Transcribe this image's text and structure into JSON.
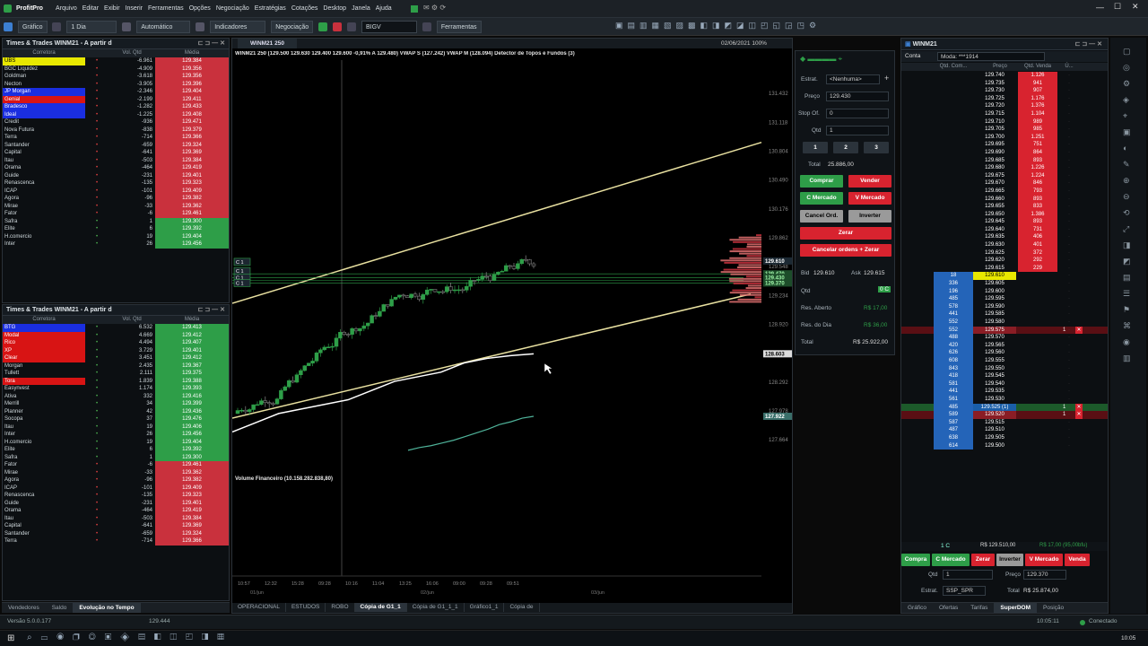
{
  "app": {
    "name": "ProfitPro"
  },
  "menu": [
    "Arquivo",
    "Editar",
    "Exibir",
    "Inserir",
    "Ferramentas",
    "Opções",
    "Negociação",
    "Estratégias",
    "Cotações",
    "Desktop",
    "Janela",
    "Ajuda"
  ],
  "toolbar": {
    "chart_label": "Gráfico",
    "period": "1 Dia",
    "mode": "Automático",
    "indicators": "Indicadores",
    "trading": "Negociação",
    "ticker": "BIGV",
    "tools": "Ferramentas"
  },
  "tt_top": {
    "title": "Times & Trades WINM21 - A partir d",
    "headers": {
      "broker": "Corretora",
      "qty": "Vol. Qtd",
      "avg": "Média"
    },
    "rows": [
      {
        "name": "UBS",
        "qty": "-6.961",
        "avg": "129.384",
        "bg": "#e8e800",
        "fg": "#000"
      },
      {
        "name": "BGC Liquidez",
        "qty": "-4.909",
        "avg": "129.356"
      },
      {
        "name": "Goldman",
        "qty": "-3.618",
        "avg": "129.356"
      },
      {
        "name": "Necton",
        "qty": "-3.905",
        "avg": "129.396"
      },
      {
        "name": "JP Morgan",
        "qty": "-2.346",
        "avg": "129.404",
        "bg": "#1a2ee0"
      },
      {
        "name": "Genial",
        "qty": "-2.199",
        "avg": "129.411",
        "bg": "#d81414"
      },
      {
        "name": "Bradesco",
        "qty": "-1.282",
        "avg": "129.433",
        "bg": "#1a2ee0"
      },
      {
        "name": "Ideal",
        "qty": "-1.225",
        "avg": "129.408",
        "bg": "#1a2ee0"
      },
      {
        "name": "Credit",
        "qty": "-936",
        "avg": "129.471"
      },
      {
        "name": "Nova Futura",
        "qty": "-838",
        "avg": "129.379"
      },
      {
        "name": "Terra",
        "qty": "-714",
        "avg": "129.366"
      },
      {
        "name": "Santander",
        "qty": "-659",
        "avg": "129.324"
      },
      {
        "name": "Capital",
        "qty": "-641",
        "avg": "129.369"
      },
      {
        "name": "Itau",
        "qty": "-503",
        "avg": "129.384"
      },
      {
        "name": "Orama",
        "qty": "-464",
        "avg": "129.419"
      },
      {
        "name": "Guide",
        "qty": "-231",
        "avg": "129.401"
      },
      {
        "name": "Renascenca",
        "qty": "-135",
        "avg": "129.323"
      },
      {
        "name": "ICAP",
        "qty": "-101",
        "avg": "129.409"
      },
      {
        "name": "Agora",
        "qty": "-96",
        "avg": "129.382"
      },
      {
        "name": "Mirae",
        "qty": "-33",
        "avg": "129.362"
      },
      {
        "name": "Fator",
        "qty": "-6",
        "avg": "129.461"
      },
      {
        "name": "Safra",
        "qty": "1",
        "avg": "129.300",
        "pos": true
      },
      {
        "name": "Elite",
        "qty": "6",
        "avg": "129.392",
        "pos": true
      },
      {
        "name": "H.comercio",
        "qty": "19",
        "avg": "129.404",
        "pos": true
      },
      {
        "name": "Inter",
        "qty": "26",
        "avg": "129.456",
        "pos": true
      }
    ]
  },
  "tt_bottom": {
    "title": "Times & Trades WINM21 - A partir d",
    "headers": {
      "broker": "Corretora",
      "qty": "Vol. Qtd",
      "avg": "Média"
    },
    "rows": [
      {
        "name": "BTG",
        "qty": "6.532",
        "avg": "129.413",
        "pos": true,
        "bg": "#1a2ee0"
      },
      {
        "name": "Modal",
        "qty": "4.669",
        "avg": "129.412",
        "pos": true,
        "bg": "#d81414"
      },
      {
        "name": "Rico",
        "qty": "4.494",
        "avg": "129.407",
        "pos": true,
        "bg": "#d81414"
      },
      {
        "name": "XP",
        "qty": "3.729",
        "avg": "129.401",
        "pos": true,
        "bg": "#d81414"
      },
      {
        "name": "Clear",
        "qty": "3.451",
        "avg": "129.412",
        "pos": true,
        "bg": "#d81414"
      },
      {
        "name": "Morgan",
        "qty": "2.435",
        "avg": "129.367",
        "pos": true
      },
      {
        "name": "Tullett",
        "qty": "2.111",
        "avg": "129.375",
        "pos": true
      },
      {
        "name": "Tora",
        "qty": "1.839",
        "avg": "129.388",
        "pos": true,
        "bg": "#d81414"
      },
      {
        "name": "Easynvest",
        "qty": "1.174",
        "avg": "129.393",
        "pos": true
      },
      {
        "name": "Ativa",
        "qty": "332",
        "avg": "129.416",
        "pos": true
      },
      {
        "name": "Merrill",
        "qty": "34",
        "avg": "129.399",
        "pos": true
      },
      {
        "name": "Planner",
        "qty": "42",
        "avg": "129.436",
        "pos": true
      },
      {
        "name": "Socopa",
        "qty": "37",
        "avg": "129.476",
        "pos": true
      },
      {
        "name": "Itau",
        "qty": "19",
        "avg": "129.406",
        "pos": true
      },
      {
        "name": "Inter",
        "qty": "26",
        "avg": "129.456",
        "pos": true
      },
      {
        "name": "H.comercio",
        "qty": "19",
        "avg": "129.404",
        "pos": true
      },
      {
        "name": "Elite",
        "qty": "6",
        "avg": "129.392",
        "pos": true
      },
      {
        "name": "Safra",
        "qty": "1",
        "avg": "129.300",
        "pos": true
      },
      {
        "name": "Fator",
        "qty": "-6",
        "avg": "129.461"
      },
      {
        "name": "Mirae",
        "qty": "-33",
        "avg": "129.362"
      },
      {
        "name": "Agora",
        "qty": "-96",
        "avg": "129.382"
      },
      {
        "name": "ICAP",
        "qty": "-101",
        "avg": "129.409"
      },
      {
        "name": "Renascenca",
        "qty": "-135",
        "avg": "129.323"
      },
      {
        "name": "Guide",
        "qty": "-231",
        "avg": "129.401"
      },
      {
        "name": "Orama",
        "qty": "-464",
        "avg": "129.419"
      },
      {
        "name": "Itau",
        "qty": "-503",
        "avg": "129.384"
      },
      {
        "name": "Capital",
        "qty": "-641",
        "avg": "129.369"
      },
      {
        "name": "Santander",
        "qty": "-659",
        "avg": "129.324"
      },
      {
        "name": "Terra",
        "qty": "-714",
        "avg": "129.366"
      }
    ]
  },
  "left_bottom_tabs": [
    "Vendedores",
    "Saldo",
    "Evolução no Tempo"
  ],
  "chart": {
    "tab": "WINM21 250",
    "datetime": "02/06/2021 100%",
    "legend": "WINM21 250 (129.500 129.630 129.400 129.600 -0,91% A 129.480) VWAP S (127.242) VWAP M (128.094) Detector de Topos e Fundos (3)",
    "volume_label": "Volume Financeiro (10.158.282.838,80)",
    "price_ticks": [
      "131.432",
      "131.118",
      "130.804",
      "130.490",
      "130.176",
      "129.862",
      "129.548",
      "129.234",
      "128.920",
      "128.606",
      "128.292",
      "127.978",
      "127.664"
    ],
    "price_min": 127.5,
    "price_max": 131.6,
    "time_ticks": [
      "10:57",
      "12:32",
      "15:28",
      "09:28",
      "10:16",
      "11:04",
      "13:25",
      "16:06",
      "09:00",
      "09:28",
      "09:51"
    ],
    "date_labels": [
      "01/jun",
      "02/jun",
      "03/jun"
    ],
    "price_tags": [
      {
        "text": "129.610",
        "bg": "#1c2933",
        "fg": "#ffffff",
        "price": 129.61
      },
      {
        "text": "129.470",
        "bg": "#1d4d2a",
        "fg": "#9ff5a8",
        "price": 129.47
      },
      {
        "text": "129.430",
        "bg": "#1d4d2a",
        "fg": "#9ff5a8",
        "price": 129.43
      },
      {
        "text": "129.370",
        "bg": "#1d4d2a",
        "fg": "#9ff5a8",
        "price": 129.37
      },
      {
        "text": "128.603",
        "bg": "#dddddd",
        "fg": "#000000",
        "price": 128.6
      },
      {
        "text": "127.922",
        "bg": "#3a6f6a",
        "fg": "#ffffff",
        "price": 127.92
      }
    ],
    "order_tags": [
      "C 1",
      "C 1",
      "C 1",
      "C 1"
    ],
    "tabs": [
      "OPERACIONAL",
      "ESTUDOS",
      "ROBO",
      "Cópia de G1_1",
      "Cópia de G1_1_1",
      "Gráfico1_1",
      "Cópia de"
    ]
  },
  "chart_data": {
    "type": "line",
    "series": [
      {
        "values": [
          127.75,
          127.85,
          127.95,
          128.0,
          128.05,
          128.1,
          128.2,
          128.3,
          128.35,
          128.4,
          128.5,
          128.55,
          128.58,
          128.6
        ]
      },
      {
        "values": [
          127.55,
          127.58,
          127.6,
          127.63,
          127.66,
          127.7,
          127.74,
          127.78,
          127.83,
          127.86,
          127.9,
          127.92
        ]
      }
    ],
    "ylim": [
      127.5,
      131.6
    ]
  },
  "boleta": {
    "labels": {
      "estrat": "Estrat.",
      "preco": "Preço",
      "stop": "Stop Of.",
      "qtd": "Qtd",
      "total": "Total"
    },
    "values": {
      "estrat": "<Nenhuma>",
      "preco": "129.430",
      "stop": "0",
      "qtd": "1",
      "total": "25.886,00"
    },
    "qty_buttons": [
      "1",
      "2",
      "3"
    ],
    "buttons": {
      "comprar": "Comprar",
      "vender": "Vender",
      "cmercado": "C Mercado",
      "vmercado": "V Mercado",
      "cancel": "Cancel Ord.",
      "inverter": "Inverter",
      "zerar": "Zerar",
      "cancelar_zerar": "Cancelar ordens + Zerar"
    },
    "stats": {
      "bid_label": "Bid",
      "bid": "129.610",
      "ask_label": "Ask",
      "ask": "129.615",
      "qtd_label": "Qtd",
      "pos": "0 C",
      "res_label": "Res. Aberto",
      "res": "R$ 17,00",
      "resdia_label": "Res. do Dia",
      "resdia": "R$ 36,00",
      "total_label": "Total",
      "total": "R$ 25.922,00"
    }
  },
  "dom": {
    "title": "WINM21",
    "tab_left": "Conta",
    "mode": "Moda: ***1914",
    "headers": {
      "qtdcomp": "Qtd. Com...",
      "preco": "Preço",
      "qtdvend": "Qtd. Venda",
      "saldo": "Ú..."
    },
    "rows": [
      {
        "price": "129.740",
        "sell": "1.126"
      },
      {
        "price": "129.735",
        "sell": "941"
      },
      {
        "price": "129.730",
        "sell": "907"
      },
      {
        "price": "129.725",
        "sell": "1.176"
      },
      {
        "price": "129.720",
        "sell": "1.376"
      },
      {
        "price": "129.715",
        "sell": "1.104"
      },
      {
        "price": "129.710",
        "sell": "989"
      },
      {
        "price": "129.705",
        "sell": "985"
      },
      {
        "price": "129.700",
        "sell": "1.251"
      },
      {
        "price": "129.695",
        "sell": "751"
      },
      {
        "price": "129.690",
        "sell": "864"
      },
      {
        "price": "129.685",
        "sell": "893"
      },
      {
        "price": "129.680",
        "sell": "1.226"
      },
      {
        "price": "129.675",
        "sell": "1.224"
      },
      {
        "price": "129.670",
        "sell": "846"
      },
      {
        "price": "129.665",
        "sell": "793"
      },
      {
        "price": "129.660",
        "sell": "893"
      },
      {
        "price": "129.655",
        "sell": "833"
      },
      {
        "price": "129.650",
        "sell": "1.386"
      },
      {
        "price": "129.645",
        "sell": "893"
      },
      {
        "price": "129.640",
        "sell": "731"
      },
      {
        "price": "129.635",
        "sell": "406"
      },
      {
        "price": "129.630",
        "sell": "401"
      },
      {
        "price": "129.625",
        "sell": "372"
      },
      {
        "price": "129.620",
        "sell": "292"
      },
      {
        "price": "129.615",
        "sell": "229"
      },
      {
        "price": "129.610",
        "buy": "18",
        "hl": "yellow"
      },
      {
        "price": "129.605",
        "buy": "336"
      },
      {
        "price": "129.600",
        "buy": "196"
      },
      {
        "price": "129.595",
        "buy": "485"
      },
      {
        "price": "129.590",
        "buy": "578"
      },
      {
        "price": "129.585",
        "buy": "441"
      },
      {
        "price": "129.580",
        "buy": "552"
      },
      {
        "price": "129.575",
        "buy": "552",
        "hl": "red",
        "mark": "1"
      },
      {
        "price": "129.570",
        "buy": "488"
      },
      {
        "price": "129.565",
        "buy": "420"
      },
      {
        "price": "129.560",
        "buy": "626"
      },
      {
        "price": "129.555",
        "buy": "608"
      },
      {
        "price": "129.550",
        "buy": "843"
      },
      {
        "price": "129.545",
        "buy": "418"
      },
      {
        "price": "129.540",
        "buy": "581"
      },
      {
        "price": "129.535",
        "buy": "441"
      },
      {
        "price": "129.530",
        "buy": "561"
      },
      {
        "price": "129.525 (1)",
        "buy": "485",
        "hl": "green",
        "mark": "1"
      },
      {
        "price": "129.520",
        "buy": "589",
        "hl": "red",
        "mark": "1"
      },
      {
        "price": "129.515",
        "buy": "587"
      },
      {
        "price": "129.510",
        "buy": "487"
      },
      {
        "price": "129.505",
        "buy": "638"
      },
      {
        "price": "129.500",
        "buy": "614"
      }
    ],
    "summary": {
      "pos": "1 C",
      "price": "R$ 129.510,00",
      "res": "R$ 17,00 (95,00bfu)"
    },
    "actions": [
      "Compra",
      "C Mercado",
      "Zerar",
      "Inverter",
      "V Mercado",
      "Venda"
    ],
    "qtd_label": "Qtd",
    "qtd": "1",
    "preco_label": "Preço",
    "preco": "129.370",
    "estrat_label": "Estrat.",
    "estrat": "SSP_SPR",
    "total_label": "Total",
    "total": "R$ 25.874,00",
    "tabs": [
      "Gráfico",
      "Ofertas",
      "Tarifas",
      "SuperDOM",
      "Posição"
    ]
  },
  "status": {
    "version": "Versão 5.0.0.177",
    "price": "129.444",
    "time": "10:05:11",
    "connection": "Conectado",
    "clock": "10:05"
  },
  "colors": {
    "sell": "#c9313d",
    "buy": "#2e9e48",
    "dom_sell_bg": "#8a1d25",
    "dom_buy_bg": "#1d4e8a"
  }
}
